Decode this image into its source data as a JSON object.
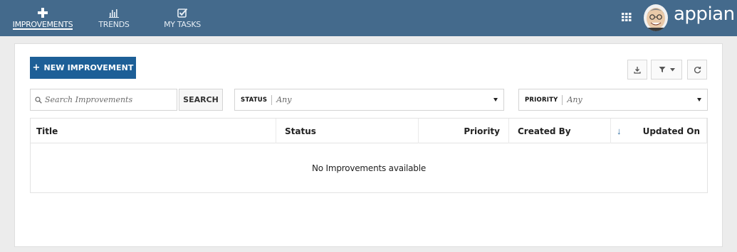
{
  "nav": {
    "tabs": [
      {
        "label": "IMPROVEMENTS",
        "icon": "plus-icon",
        "active": true
      },
      {
        "label": "TRENDS",
        "icon": "bar-chart-icon",
        "active": false
      },
      {
        "label": "MY TASKS",
        "icon": "checkbox-icon",
        "active": false
      }
    ],
    "apps_icon": "grid-icon",
    "logo_text": "appian"
  },
  "toolbar": {
    "new_button_label": "NEW IMPROVEMENT",
    "new_button_icon": "+",
    "export_icon": "download-icon",
    "filter_icon": "filter-icon",
    "refresh_icon": "refresh-icon"
  },
  "search": {
    "placeholder": "Search Improvements",
    "button_label": "SEARCH"
  },
  "filters": {
    "status": {
      "label": "STATUS",
      "value": "Any"
    },
    "priority": {
      "label": "PRIORITY",
      "value": "Any"
    }
  },
  "grid": {
    "columns": [
      "Title",
      "Status",
      "Priority",
      "Created By",
      "Updated On"
    ],
    "sort_column": "Updated On",
    "sort_direction": "descending",
    "empty_message": "No Improvements available"
  },
  "colors": {
    "header_bg": "#446a8c",
    "primary_button": "#1d5f97",
    "sort_arrow": "#2d6aa0"
  }
}
